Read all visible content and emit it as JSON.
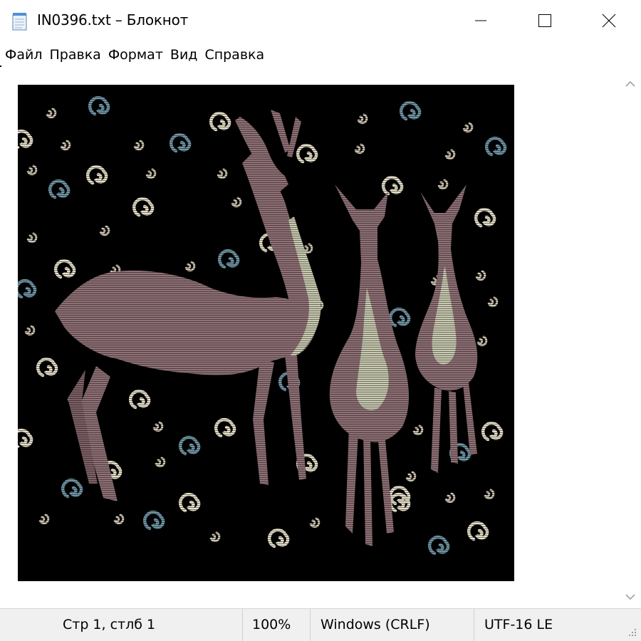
{
  "window": {
    "title": "IN0396.txt – Блокнот",
    "icon": "notepad-icon",
    "controls": [
      "minimize-icon",
      "maximize-icon",
      "close-icon"
    ]
  },
  "menu": {
    "items": [
      "Файл",
      "Правка",
      "Формат",
      "Вид",
      "Справка"
    ]
  },
  "document": {
    "content": "ascii-art image: three stylized gazelles among spirals",
    "colors": {
      "background": "#000000",
      "body": "#8f7176",
      "neck": "#c9cab0",
      "spiral_light": "#e6dfc8",
      "spiral_blue": "#6f95a5"
    }
  },
  "status": {
    "position": "Стр 1, стлб 1",
    "zoom": "100%",
    "line_ending": "Windows (CRLF)",
    "encoding": "UTF-16 LE"
  }
}
